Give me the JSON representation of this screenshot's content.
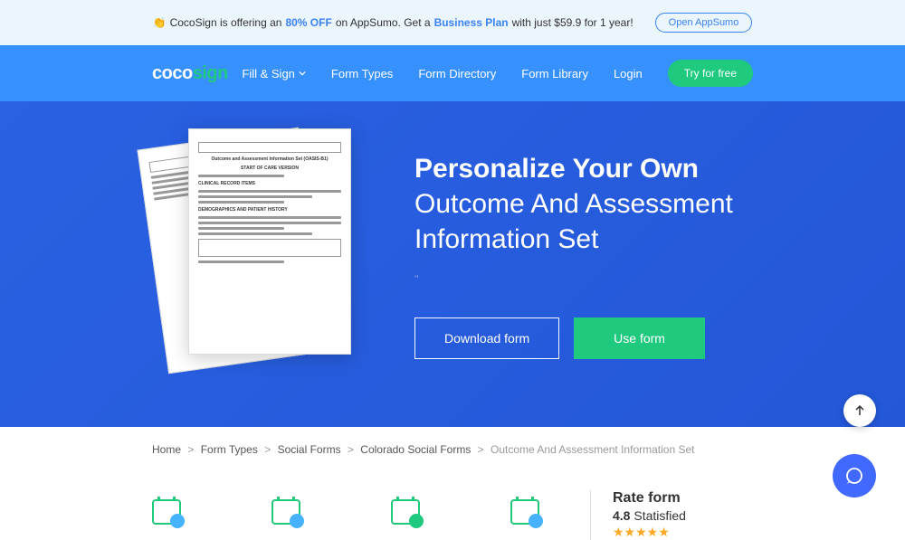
{
  "promo": {
    "prefix": "CocoSign is offering an",
    "discount": "80% OFF",
    "mid1": "on AppSumo. Get a",
    "plan": "Business Plan",
    "suffix": "with just $59.9 for 1 year!",
    "button": "Open AppSumo"
  },
  "logo": {
    "part1": "coco",
    "part2": "sign"
  },
  "nav": {
    "fillSign": "Fill & Sign",
    "formTypes": "Form Types",
    "formDirectory": "Form Directory",
    "formLibrary": "Form Library",
    "login": "Login",
    "tryFree": "Try for free"
  },
  "hero": {
    "titleBold": "Personalize Your Own",
    "titleRest": "Outcome And Assessment Information Set",
    "download": "Download form",
    "use": "Use form"
  },
  "breadcrumb": {
    "items": [
      "Home",
      "Form Types",
      "Social Forms",
      "Colorado Social Forms"
    ],
    "current": "Outcome And Assessment Information Set"
  },
  "rate": {
    "title": "Rate form",
    "score": "4.8",
    "label": "Statisfied",
    "stars": "★★★★★"
  }
}
